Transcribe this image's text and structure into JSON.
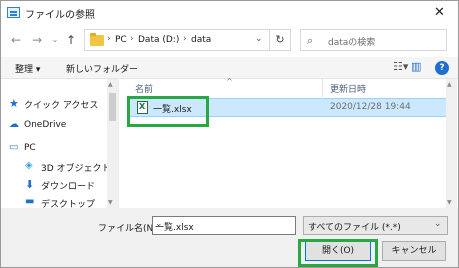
{
  "window": {
    "title": "ファイルの参照",
    "close_glyph": "✕"
  },
  "address": {
    "crumbs": [
      "PC",
      "Data (D:)",
      "data"
    ],
    "separator": "›",
    "search_placeholder": "dataの検索"
  },
  "toolbar": {
    "organize": "整理 ▾",
    "new_folder": "新しいフォルダー",
    "help": "?"
  },
  "nav": {
    "items": [
      "クイック アクセス",
      "OneDrive",
      "PC",
      "3D オブジェクト",
      "ダウンロード",
      "デスクトップ"
    ]
  },
  "files": {
    "columns": [
      "名前",
      "更新日時"
    ],
    "rows": [
      {
        "name": "一覧.xlsx",
        "modified": "2020/12/28 19:44",
        "selected": true
      }
    ]
  },
  "footer": {
    "filename_label": "ファイル名(N):",
    "filename_value": "一覧.xlsx",
    "filetype": "すべてのファイル (*.*)",
    "open_button": "開く(O)",
    "cancel_button": "キャンセル"
  },
  "colors": {
    "selection": "#cce8ff",
    "highlight": "#28a745",
    "accent": "#0078d7"
  }
}
